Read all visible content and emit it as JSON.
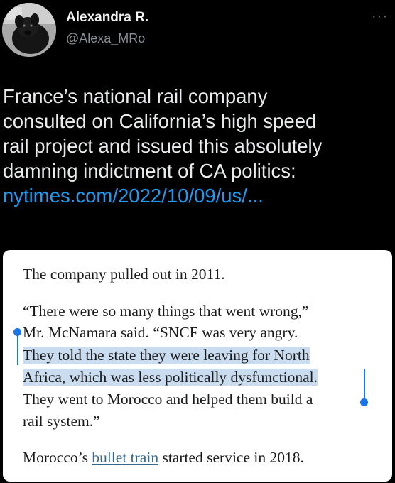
{
  "author": {
    "name": "Alexandra R.",
    "handle": "@Alexa_MRo",
    "more_icon": "more-horizontal-icon"
  },
  "tweet": {
    "text": "France’s national rail company\nconsulted on California’s high speed\nrail project and issued this absolutely\ndamning indictment of CA politics:",
    "link": "nytimes.com/2022/10/09/us/..."
  },
  "article": {
    "p1": "The company pulled out in 2011.",
    "lines": [
      "“There were so many things that went wrong,”",
      "Mr. McNamara said. “SNCF was very angry.",
      "They told the state they were leaving for North",
      "Africa, which was less politically dysfunctional.",
      "They went to Morocco and helped them build a",
      "rail system.”"
    ],
    "p3_before": "Morocco’s ",
    "p3_link": "bullet train",
    "p3_after": " started service in 2018."
  },
  "colors": {
    "background": "#000000",
    "link": "#1d9bf0",
    "highlight": "#c9dcf0",
    "selection_handle": "#1a73e8"
  }
}
